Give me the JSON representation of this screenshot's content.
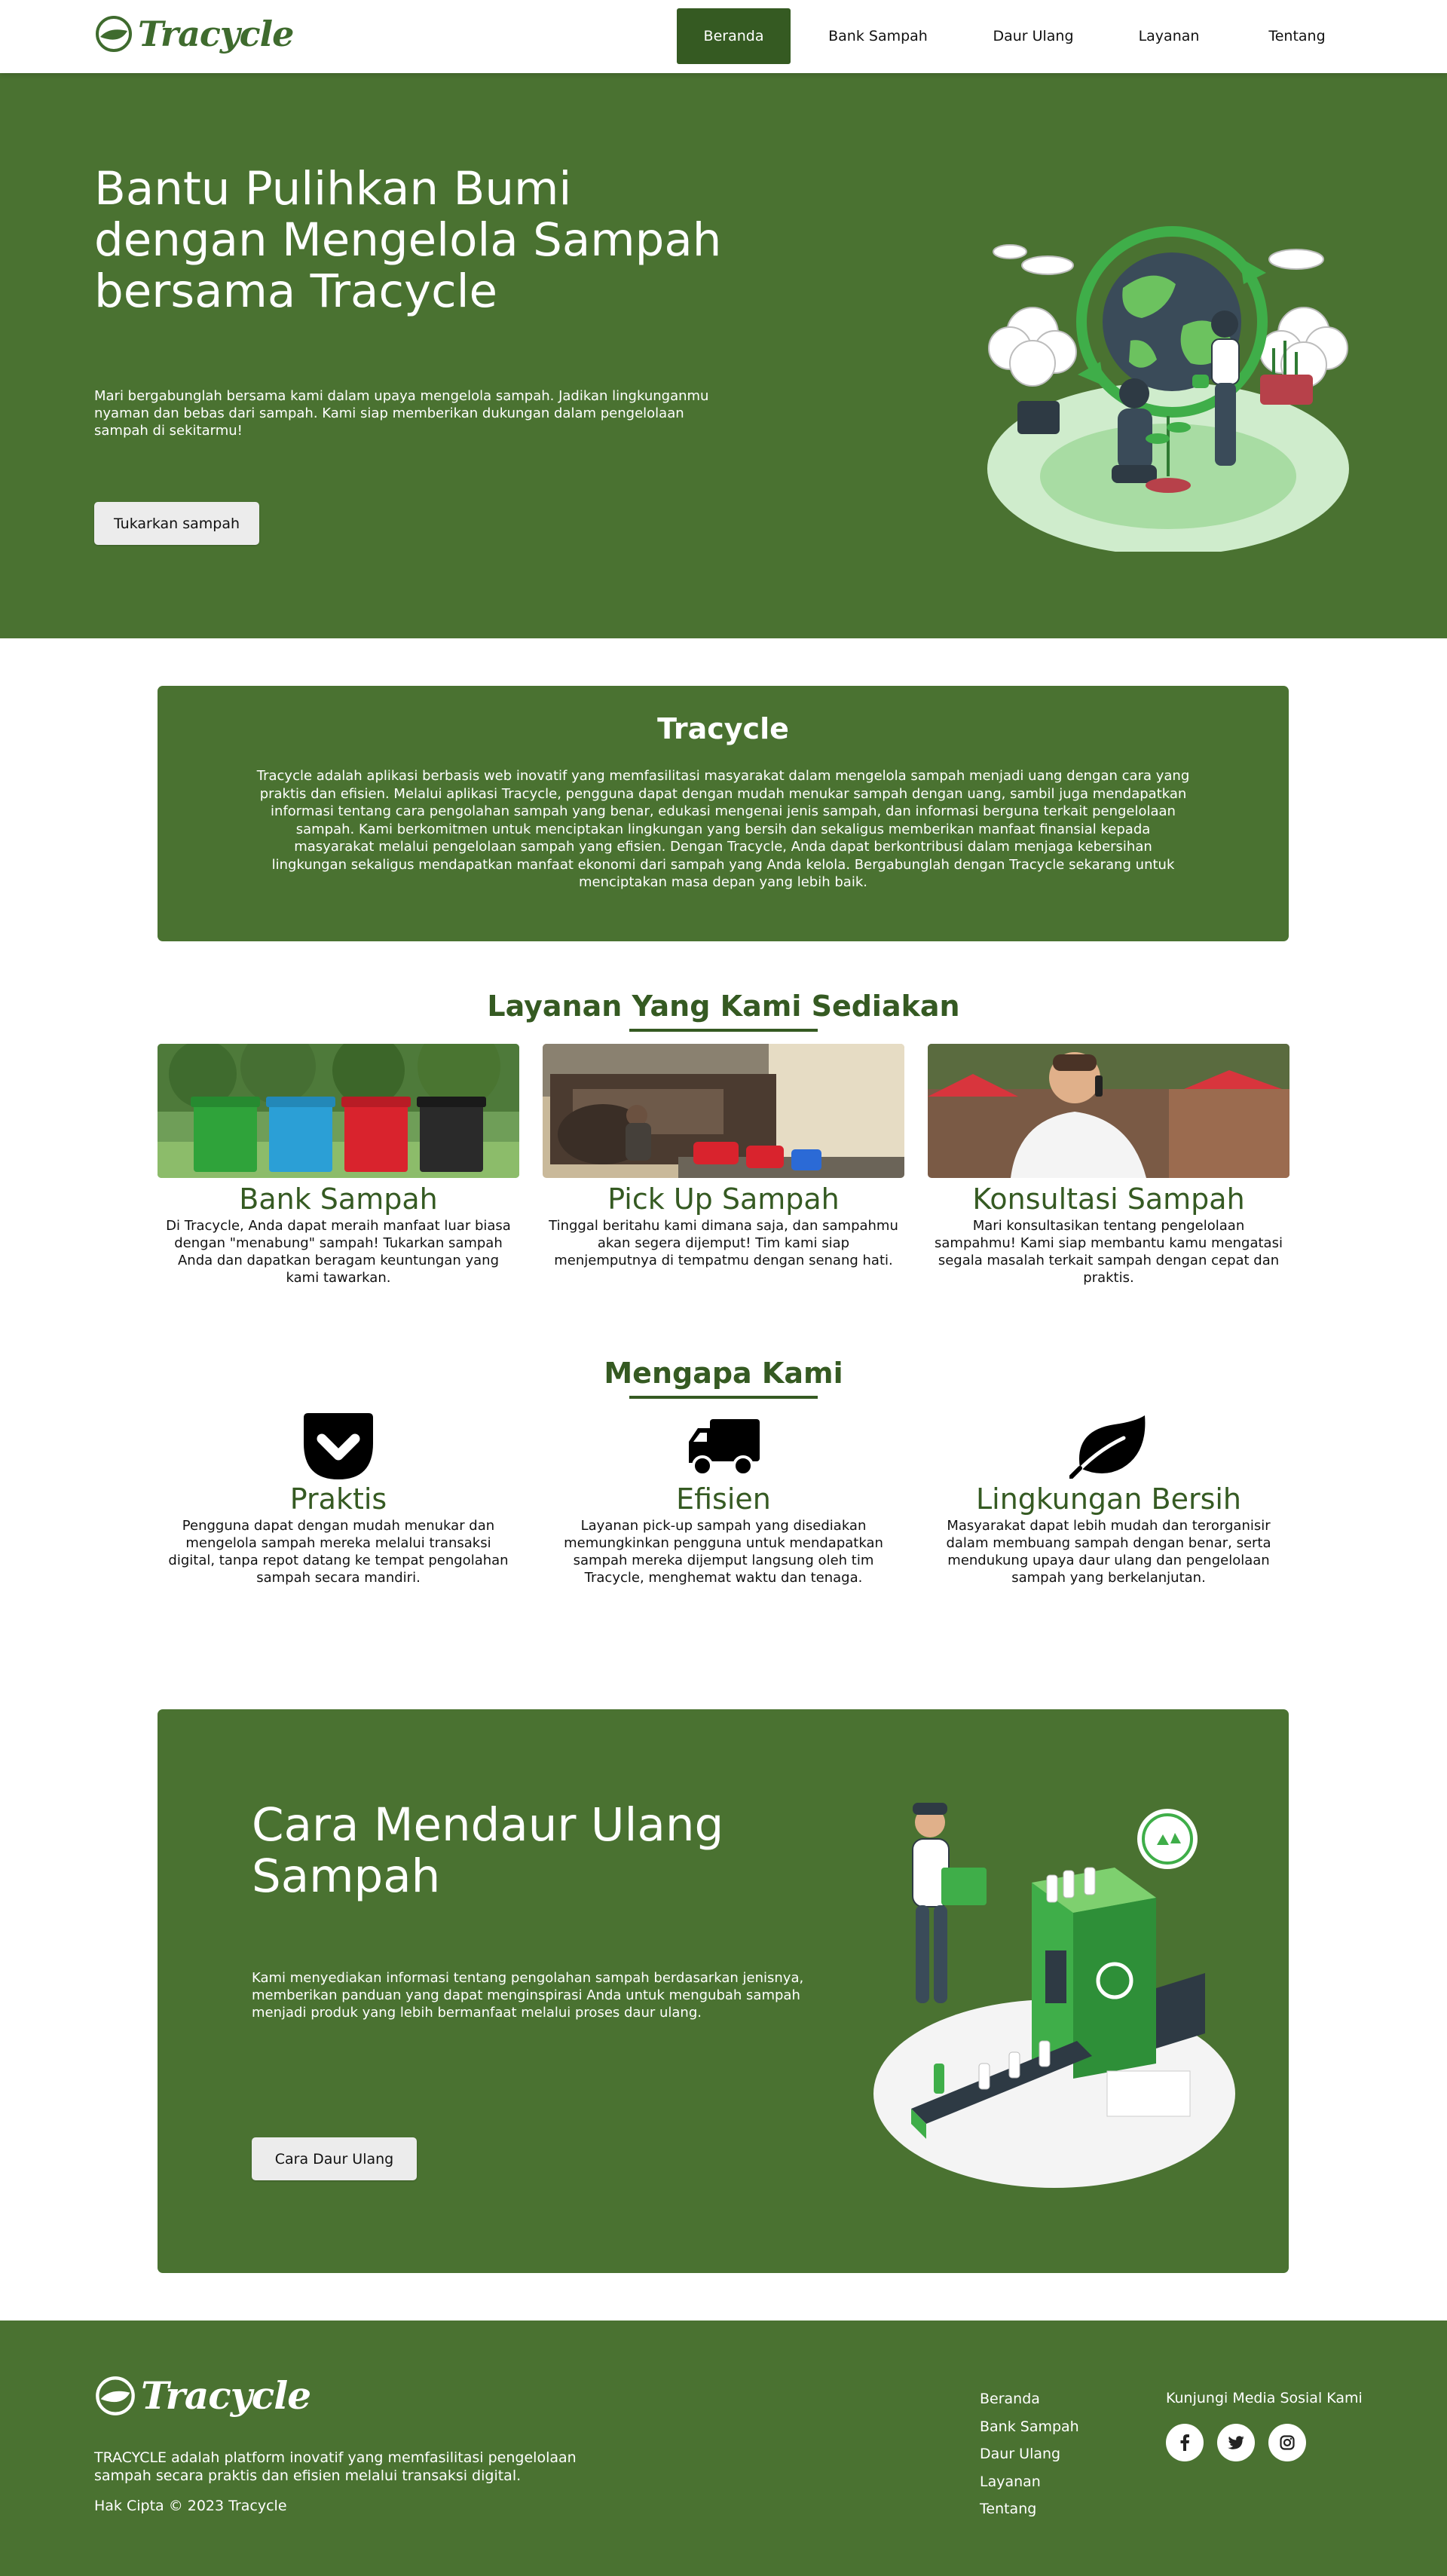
{
  "brand": {
    "name": "Tracycle"
  },
  "nav": {
    "items": [
      {
        "label": "Beranda",
        "active": true
      },
      {
        "label": "Bank Sampah",
        "active": false
      },
      {
        "label": "Daur Ulang",
        "active": false
      },
      {
        "label": "Layanan",
        "active": false
      },
      {
        "label": "Tentang",
        "active": false
      }
    ]
  },
  "hero": {
    "title": "Bantu Pulihkan Bumi dengan Mengelola Sampah bersama Tracycle",
    "description": "Mari bergabunglah bersama kami dalam upaya mengelola sampah. Jadikan lingkunganmu nyaman dan bebas dari sampah. Kami siap memberikan dukungan dalam pengelolaan sampah di sekitarmu!",
    "button_label": "Tukarkan sampah"
  },
  "about": {
    "title": "Tracycle",
    "text": "Tracycle adalah aplikasi berbasis web inovatif yang memfasilitasi masyarakat dalam mengelola sampah menjadi uang dengan cara yang praktis dan efisien. Melalui aplikasi Tracycle, pengguna dapat dengan mudah menukar sampah dengan uang, sambil juga mendapatkan informasi tentang cara pengolahan sampah yang benar, edukasi mengenai jenis sampah, dan informasi berguna terkait pengelolaan sampah. Kami berkomitmen untuk menciptakan lingkungan yang bersih dan sekaligus memberikan manfaat finansial kepada masyarakat melalui pengelolaan sampah yang efisien. Dengan Tracycle, Anda dapat berkontribusi dalam menjaga kebersihan lingkungan sekaligus mendapatkan manfaat ekonomi dari sampah yang Anda kelola. Bergabunglah dengan Tracycle sekarang untuk menciptakan masa depan yang lebih baik."
  },
  "services": {
    "title": "Layanan Yang Kami Sediakan",
    "items": [
      {
        "name": "Bank Sampah",
        "description": "Di Tracycle, Anda dapat meraih manfaat luar biasa dengan \"menabung\" sampah! Tukarkan sampah Anda dan dapatkan beragam keuntungan yang kami tawarkan.",
        "image": "colorful-trash-bins-photo"
      },
      {
        "name": "Pick Up Sampah",
        "description": "Tinggal beritahu kami dimana saja, dan sampahmu akan segera dijemput! Tim kami siap menjemputnya di tempatmu dengan senang hati.",
        "image": "garbage-truck-photo"
      },
      {
        "name": "Konsultasi Sampah",
        "description": "Mari konsultasikan tentang pengelolaan sampahmu! Kami siap membantu kamu mengatasi segala masalah terkait sampah dengan cepat dan praktis.",
        "image": "man-on-phone-photo"
      }
    ]
  },
  "why": {
    "title": "Mengapa Kami",
    "items": [
      {
        "name": "Praktis",
        "description": "Pengguna dapat dengan mudah menukar dan mengelola sampah mereka melalui transaksi digital, tanpa repot datang ke tempat pengolahan sampah secara mandiri.",
        "icon": "pocket-icon"
      },
      {
        "name": "Efisien",
        "description": "Layanan pick-up sampah yang disediakan memungkinkan pengguna untuk mendapatkan sampah mereka dijemput langsung oleh tim Tracycle, menghemat waktu dan tenaga.",
        "icon": "truck-icon"
      },
      {
        "name": "Lingkungan Bersih",
        "description": "Masyarakat dapat lebih mudah dan terorganisir dalam membuang sampah dengan benar, serta mendukung upaya daur ulang dan pengelolaan sampah yang berkelanjutan.",
        "icon": "leaf-icon"
      }
    ]
  },
  "recycle": {
    "title": "Cara Mendaur Ulang Sampah",
    "description": "Kami menyediakan informasi tentang pengolahan sampah berdasarkan jenisnya, memberikan panduan yang dapat menginspirasi Anda untuk mengubah sampah menjadi produk yang lebih bermanfaat melalui proses daur ulang.",
    "button_label": "Cara Daur Ulang"
  },
  "footer": {
    "about": "TRACYCLE adalah platform inovatif yang memfasilitasi pengelolaan sampah secara praktis dan efisien melalui transaksi digital.",
    "copyright": "Hak Cipta © 2023 Tracycle",
    "links": [
      "Beranda",
      "Bank Sampah",
      "Daur Ulang",
      "Layanan",
      "Tentang"
    ],
    "social_title": "Kunjungi Media Sosial Kami",
    "social_icons": [
      "facebook-icon",
      "twitter-icon",
      "instagram-icon"
    ]
  },
  "colors": {
    "primary": "#4a7231",
    "dark": "#355a22",
    "accent_green": "#3fae49"
  }
}
